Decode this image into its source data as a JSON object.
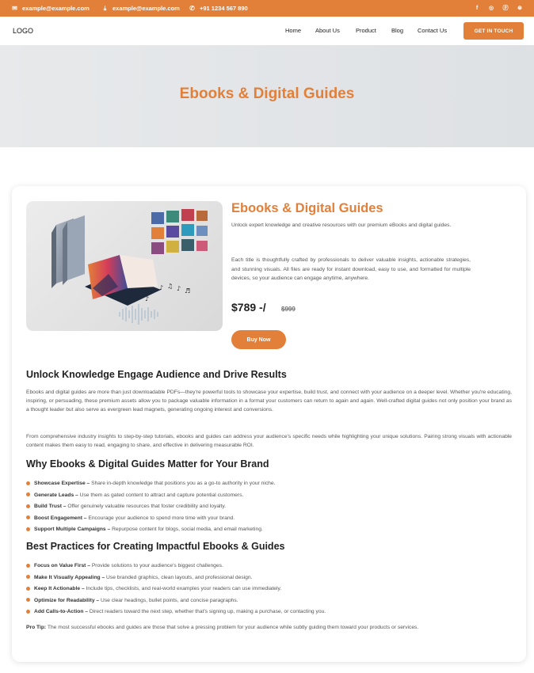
{
  "topbar": {
    "email1": "example@example.com",
    "email2": "example@example.com",
    "phone": "+91 1234 567 890",
    "social": [
      "facebook-icon",
      "instagram-icon",
      "pinterest-icon",
      "dribbble-icon"
    ]
  },
  "header": {
    "logo": "LOGO",
    "nav": [
      "Home",
      "About Us",
      "Product",
      "Blog",
      "Contact Us"
    ],
    "cta": "GET IN TOUCH"
  },
  "hero": {
    "title": "Ebooks & Digital Guides"
  },
  "product": {
    "title": "Ebooks & Digital Guides",
    "desc1": "Unlock expert knowledge and creative resources with our premium eBooks and digital guides.",
    "desc2": "Each title is thoughtfully crafted by professionals to deliver valuable insights, actionable strategies, and stunning visuals. All files are ready for instant download, easy to use, and formatted for multiple devices, so your audience can engage anytime, anywhere.",
    "price": "$789 -/",
    "old_price": "$999",
    "buy": "Buy Now"
  },
  "content": {
    "h1": "Unlock Knowledge Engage Audience and Drive Results",
    "p1": "Ebooks and digital guides are more than just downloadable PDFs—they're powerful tools to showcase your expertise, build trust, and connect with your audience on a deeper level. Whether you're educating, inspiring, or persuading, these premium assets allow you to package valuable information in a format your customers can return to again and again. Well-crafted digital guides not only position your brand as a thought leader but also serve as evergreen lead magnets, generating ongoing interest and conversions.",
    "p2": "From comprehensive industry insights to step-by-step tutorials, ebooks and guides can address your audience's specific needs while highlighting your unique solutions. Pairing strong visuals with actionable content makes them easy to read, engaging to share, and effective in delivering measurable ROI.",
    "h2": "Why Ebooks & Digital Guides Matter for Your Brand",
    "why": [
      {
        "title": "Showcase Expertise –",
        "text": " Share in-depth knowledge that positions you as a go-to authority in your niche."
      },
      {
        "title": "Generate Leads –",
        "text": " Use them as gated content to attract and capture potential customers."
      },
      {
        "title": "Build Trust –",
        "text": " Offer genuinely valuable resources that foster credibility and loyalty."
      },
      {
        "title": "Boost Engagement –",
        "text": " Encourage your audience to spend more time with your brand."
      },
      {
        "title": "Support Multiple Campaigns –",
        "text": " Repurpose content for blogs, social media, and email marketing."
      }
    ],
    "h3": "Best Practices for Creating Impactful Ebooks & Guides",
    "best": [
      {
        "title": "Focus on Value First –",
        "text": " Provide solutions to your audience's biggest challenges."
      },
      {
        "title": "Make It Visually Appealing –",
        "text": " Use branded graphics, clean layouts, and professional design."
      },
      {
        "title": "Keep It Actionable –",
        "text": " Include tips, checklists, and real-world examples your readers can use immediately."
      },
      {
        "title": "Optimize for Readability –",
        "text": " Use clear headings, bullet points, and concise paragraphs."
      },
      {
        "title": "Add Calls-to-Action –",
        "text": " Direct readers toward the next step, whether that's signing up, making a purchase, or contacting you."
      }
    ],
    "tip_label": "Pro Tip:",
    "tip_text": " The most successful ebooks and guides are those that solve a pressing problem for your audience while subtly guiding them toward your products or services."
  },
  "colors": {
    "accent": "#e2803a",
    "hero_bg": "#e3e6e9"
  }
}
